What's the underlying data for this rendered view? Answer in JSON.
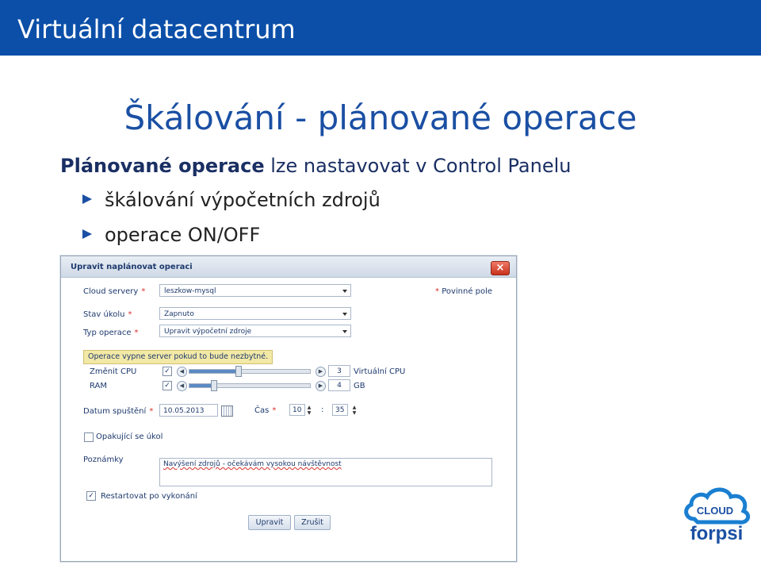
{
  "header": {
    "title": "Virtuální datacentrum"
  },
  "slide": {
    "title": "Škálování - plánované operace",
    "intro_bold": "Plánované operace",
    "intro_rest": " lze nastavovat v Control Panelu",
    "bullets": [
      "škálování výpočetních zdrojů",
      "operace ON/OFF"
    ]
  },
  "dialog": {
    "title": "Upravit naplánovat operaci",
    "close": "×",
    "fields": {
      "cloud_servers": {
        "label": "Cloud servery",
        "value": "leszkow-mysql"
      },
      "task_state": {
        "label": "Stav úkolu",
        "value": "Zapnuto"
      },
      "operation_type": {
        "label": "Typ operace",
        "value": "Upravit výpočetní zdroje"
      }
    },
    "required_star": "*",
    "required_note": "Povinné pole",
    "notice": "Operace vypne server pokud to bude nezbytné.",
    "cpu": {
      "label": "Změnit CPU",
      "checked": "✓",
      "value": "3",
      "unit": "Virtuální CPU",
      "level": 0.4
    },
    "ram": {
      "label": "RAM",
      "checked": "✓",
      "value": "4",
      "unit": "GB",
      "level": 0.2
    },
    "start_date": {
      "label": "Datum spuštění",
      "value": "10.05.2013"
    },
    "time": {
      "label": "Čas",
      "hours": "10",
      "separator": ":",
      "minutes": "35"
    },
    "repeat": {
      "label": "Opakující se úkol",
      "checked": ""
    },
    "notes": {
      "label": "Poznámky",
      "value": "Navýšení zdrojů - očekávám vysokou návštěvnost"
    },
    "restart": {
      "label": "Restartovat po vykonání",
      "checked": "✓"
    },
    "buttons": {
      "save": "Upravit",
      "cancel": "Zrušit"
    }
  },
  "logo": {
    "word_top": "CLOUD",
    "word_bottom": "forpsi"
  },
  "colors": {
    "header_bg": "#0b4fa8",
    "title_blue": "#1a4fa3",
    "accent_red": "#d9302a",
    "notice_bg": "#f3e9a6"
  }
}
